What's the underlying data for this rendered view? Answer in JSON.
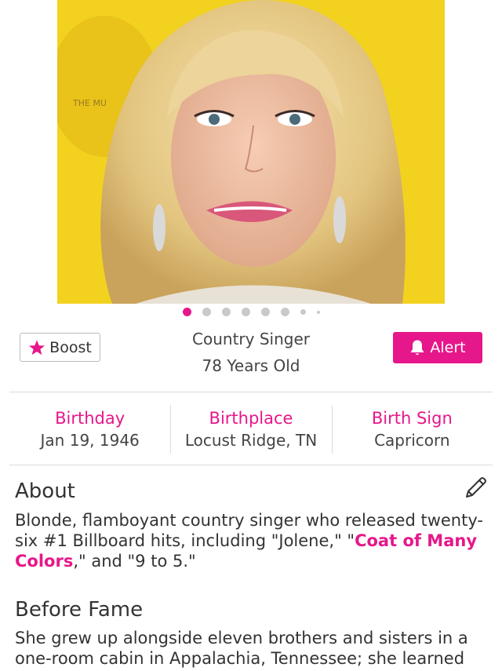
{
  "photo": {
    "alt": "Dolly Parton",
    "background_text": "THE MU"
  },
  "share": {
    "icon": "share-icon"
  },
  "carousel": {
    "dot_count": 8,
    "active_index": 0
  },
  "actions": {
    "boost_label": "Boost",
    "alert_label": "Alert"
  },
  "profile": {
    "profession": "Country Singer",
    "age": "78 Years Old"
  },
  "details": {
    "birthday_label": "Birthday",
    "birthday_value": "Jan 19, 1946",
    "birthplace_label": "Birthplace",
    "birthplace_value": "Locust Ridge, TN",
    "birthsign_label": "Birth Sign",
    "birthsign_value": "Capricorn"
  },
  "about": {
    "title": "About",
    "text_before": "Blonde, flamboyant country singer who released twenty-six #1 Billboard hits, including \"Jolene,\" \"",
    "link_text": "Coat of Many Colors",
    "text_after": ",\" and \"9 to 5.\""
  },
  "before_fame": {
    "title": "Before Fame",
    "text": "She grew up alongside eleven brothers and sisters in a one-room cabin in Appalachia, Tennessee; she learned"
  },
  "colors": {
    "accent": "#e6178a",
    "photo_background": "#f2d21f"
  }
}
